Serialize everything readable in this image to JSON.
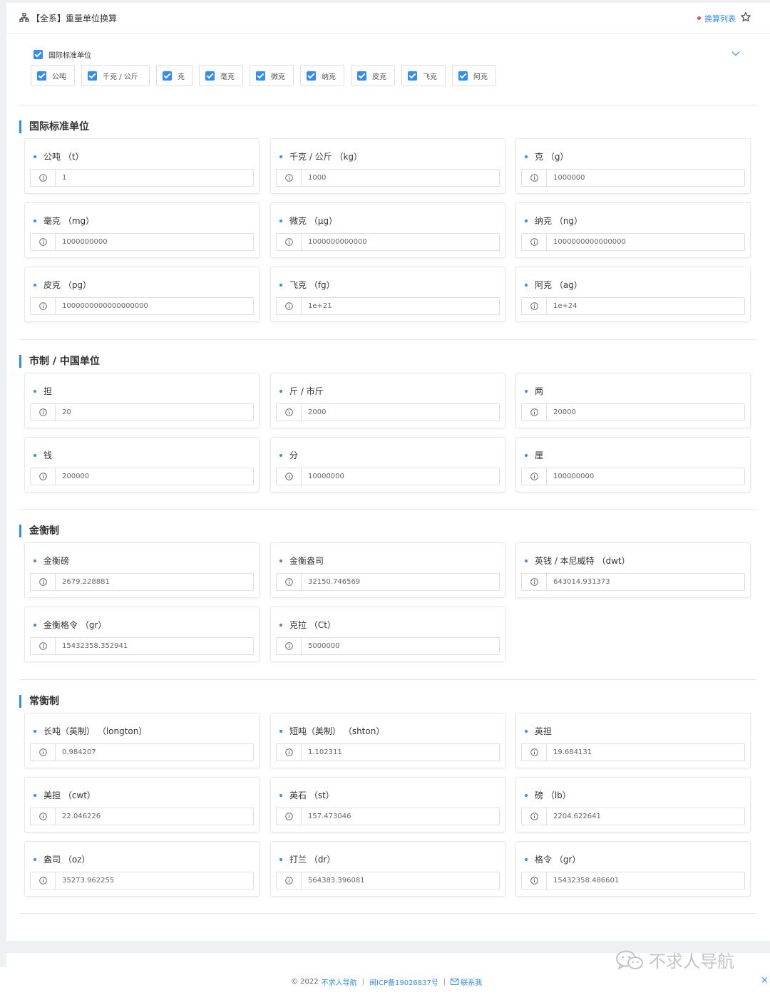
{
  "header": {
    "title": "【全系】重量单位换算",
    "list_link": "换算列表"
  },
  "filter": {
    "all_label": "国际标准单位",
    "chips": [
      "公吨",
      "千克 / 公斤",
      "克",
      "毫克",
      "微克",
      "纳克",
      "皮克",
      "飞克",
      "阿克"
    ]
  },
  "sections": [
    {
      "title": "国际标准单位",
      "cards": [
        {
          "name": "公吨 （t）",
          "value": "1"
        },
        {
          "name": "千克 / 公斤 （kg）",
          "value": "1000"
        },
        {
          "name": "克 （g）",
          "value": "1000000"
        },
        {
          "name": "毫克 （mg）",
          "value": "1000000000"
        },
        {
          "name": "微克 （μg）",
          "value": "1000000000000"
        },
        {
          "name": "纳克 （ng）",
          "value": "1000000000000000"
        },
        {
          "name": "皮克 （pg）",
          "value": "1000000000000000000"
        },
        {
          "name": "飞克 （fg）",
          "value": "1e+21"
        },
        {
          "name": "阿克 （ag）",
          "value": "1e+24"
        }
      ]
    },
    {
      "title": "市制 / 中国单位",
      "cards": [
        {
          "name": "担",
          "value": "20"
        },
        {
          "name": "斤 / 市斤",
          "value": "2000"
        },
        {
          "name": "两",
          "value": "20000"
        },
        {
          "name": "钱",
          "value": "200000"
        },
        {
          "name": "分",
          "value": "10000000"
        },
        {
          "name": "厘",
          "value": "100000000"
        }
      ]
    },
    {
      "title": "金衡制",
      "cards": [
        {
          "name": "金衡磅",
          "value": "2679.228881"
        },
        {
          "name": "金衡盎司",
          "value": "32150.746569"
        },
        {
          "name": "英钱 / 本尼威特 （dwt）",
          "value": "643014.931373"
        },
        {
          "name": "金衡格令 （gr）",
          "value": "15432358.352941"
        },
        {
          "name": "克拉 （Ct）",
          "value": "5000000"
        }
      ]
    },
    {
      "title": "常衡制",
      "cards": [
        {
          "name": "长吨（英制） （longton）",
          "value": "0.984207"
        },
        {
          "name": "短吨（美制） （shton）",
          "value": "1.102311"
        },
        {
          "name": "英担",
          "value": "19.684131"
        },
        {
          "name": "美担 （cwt）",
          "value": "22.046226"
        },
        {
          "name": "英石 （st）",
          "value": "157.473046"
        },
        {
          "name": "磅 （lb）",
          "value": "2204.622641"
        },
        {
          "name": "盎司 （oz）",
          "value": "35273.962255"
        },
        {
          "name": "打兰 （dr）",
          "value": "564383.396081"
        },
        {
          "name": "格令 （gr）",
          "value": "15432358.486601"
        }
      ]
    }
  ],
  "footer": {
    "copyright": "© 2022",
    "site": "不求人导航",
    "icp": "闽ICP备19026837号",
    "contact": "联系我"
  },
  "watermark": {
    "text": "不求人导航"
  }
}
